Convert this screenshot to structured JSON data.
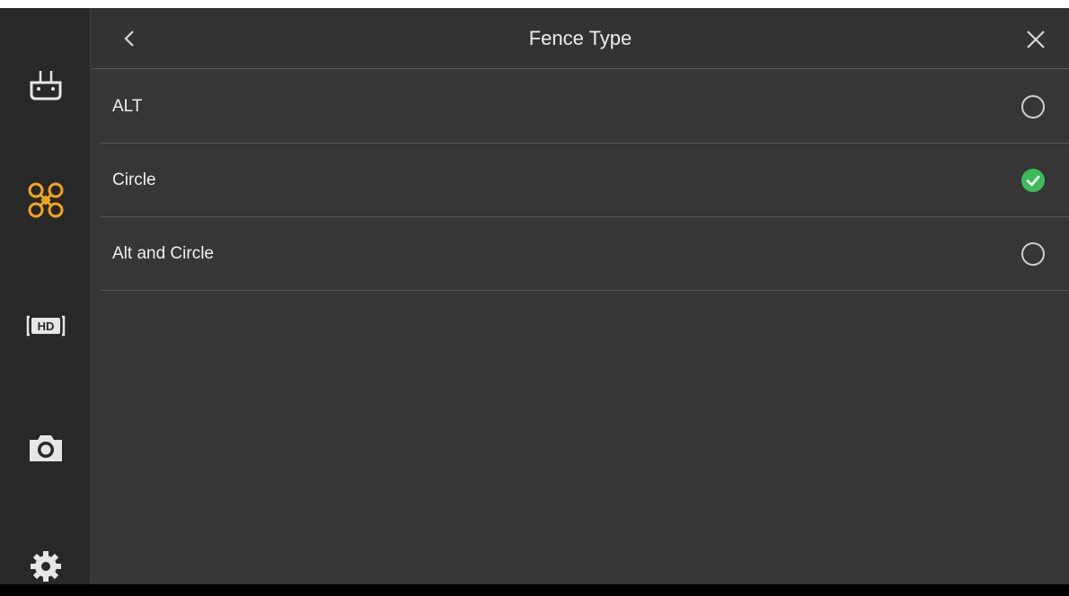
{
  "header": {
    "title": "Fence Type",
    "back_icon": "chevron-left-icon",
    "close_icon": "close-icon"
  },
  "sidebar": {
    "items": [
      {
        "name": "remote-controller",
        "icon": "remote-controller-icon",
        "active": false
      },
      {
        "name": "aircraft",
        "icon": "drone-icon",
        "active": true
      },
      {
        "name": "hd-transmission",
        "icon": "hd-icon",
        "active": false
      },
      {
        "name": "camera",
        "icon": "camera-icon",
        "active": false
      },
      {
        "name": "settings",
        "icon": "gear-icon",
        "active": false
      }
    ]
  },
  "options": [
    {
      "label": "ALT",
      "selected": false
    },
    {
      "label": "Circle",
      "selected": true
    },
    {
      "label": "Alt and Circle",
      "selected": false
    }
  ],
  "colors": {
    "accent": "#f5a51c",
    "check": "#3dbb5a",
    "background": "#363636",
    "sidebar": "#282828"
  }
}
